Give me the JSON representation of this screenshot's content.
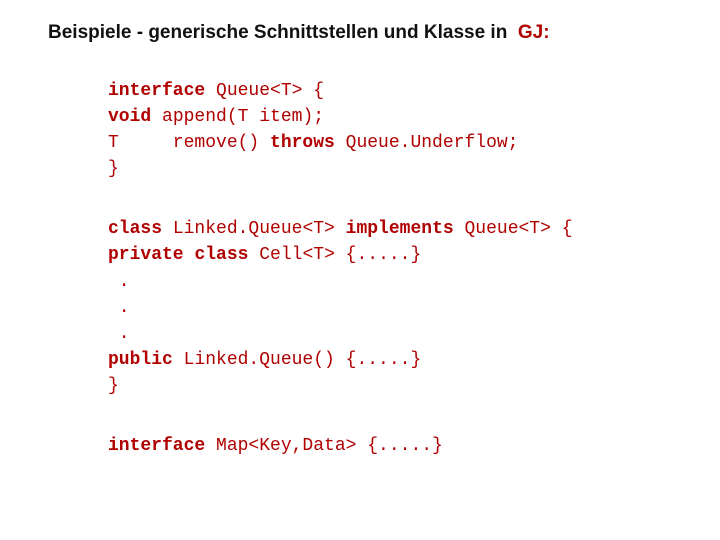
{
  "title_prefix": "Beispiele - generische Schnittstellen und Klasse in  ",
  "title_gj": "GJ:",
  "kw": {
    "interface": "interface",
    "void": "void",
    "throws": "throws",
    "class": "class",
    "implements": "implements",
    "private": "private",
    "public": "public"
  },
  "txt": {
    "b1_l1_rest": " Queue<T> {",
    "b1_l2_rest": " append(T item);",
    "b1_l3_pre": "T     remove() ",
    "b1_l3_post": " Queue.Underflow;",
    "close_brace": "}",
    "b2_l1_mid": " Linked.Queue<T> ",
    "b2_l1_end": " Queue<T> {",
    "b2_l2_rest": " Cell<T> {.....}",
    "dot_indent": " .",
    "b2_pub_rest": " Linked.Queue() {.....}",
    "b3_rest": " Map<Key,Data> {.....}"
  }
}
